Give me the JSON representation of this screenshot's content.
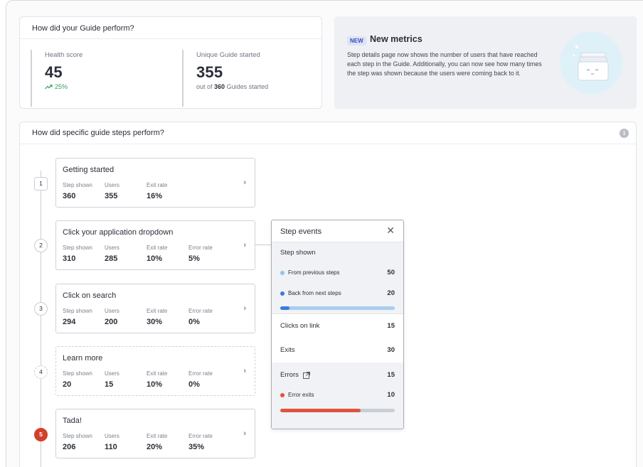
{
  "performance": {
    "title": "How did your Guide perform?",
    "health": {
      "label": "Health score",
      "value": "45",
      "trend": "25%"
    },
    "unique": {
      "label": "Unique Guide started",
      "value": "355",
      "sub_prefix": "out of",
      "sub_bold": "360",
      "sub_suffix": "Guides started"
    }
  },
  "banner": {
    "badge": "NEW",
    "title": "New metrics",
    "text": "Step details page now shows the number of users that have reached each step in the Guide. Additionally, you can now see how many times the step was shown because the users were coming back to it."
  },
  "steps_section": {
    "title": "How did specific guide steps perform?",
    "info_icon": "i",
    "columns": {
      "shown": "Step shown",
      "users": "Users",
      "exit": "Exit rate",
      "error": "Error rate"
    },
    "steps": [
      {
        "num": "1",
        "name": "Getting started",
        "shown": "360",
        "users": "355",
        "exit": "16%",
        "error": null
      },
      {
        "num": "2",
        "name": "Click your application dropdown",
        "shown": "310",
        "users": "285",
        "exit": "10%",
        "error": "5%"
      },
      {
        "num": "3",
        "name": "Click on search",
        "shown": "294",
        "users": "200",
        "exit": "30%",
        "error": "0%"
      },
      {
        "num": "4",
        "name": "Learn more",
        "shown": "20",
        "users": "15",
        "exit": "10%",
        "error": "0%"
      },
      {
        "num": "5",
        "name": "Tada!",
        "shown": "206",
        "users": "110",
        "exit": "20%",
        "error": "35%"
      }
    ]
  },
  "step_events": {
    "title": "Step events",
    "close": "✕",
    "step_shown": "Step shown",
    "from_previous": {
      "label": "From previous steps",
      "value": "50",
      "color": "#8fc3ea"
    },
    "back_from_next": {
      "label": "Back from next steps",
      "value": "20",
      "color": "#3b7ad9"
    },
    "shown_bar_fraction": 0.08,
    "clicks": {
      "label": "Clicks on link",
      "value": "15"
    },
    "exits": {
      "label": "Exits",
      "value": "30"
    },
    "errors": {
      "label": "Errors",
      "value": "15"
    },
    "error_exits": {
      "label": "Error exits",
      "value": "10",
      "color": "#e2533d"
    },
    "error_bar_fraction": 0.7
  }
}
